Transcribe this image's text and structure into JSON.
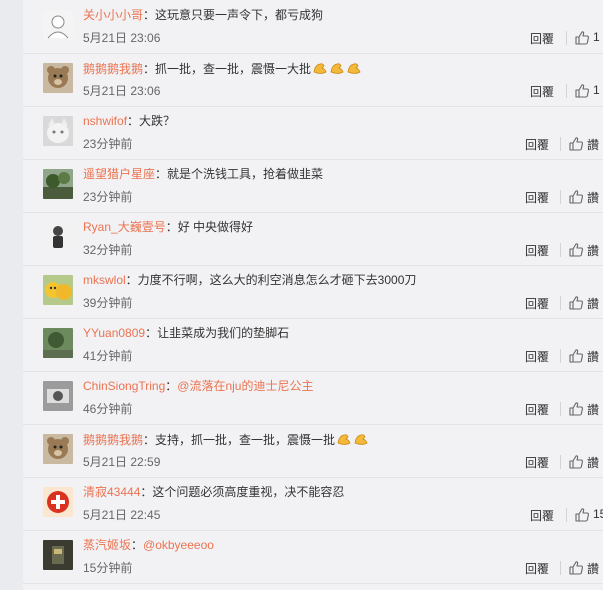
{
  "comments": [
    {
      "name": "关小小小哥",
      "text": "：这玩意只要一声令下，都亏成狗",
      "time": "5月21日 23:06",
      "reply": "回覆",
      "like": "1",
      "avatar": "avatar-white"
    },
    {
      "name": "鹅鹅鹅我鹅",
      "text": "：抓一批，查一批，震慑一大批",
      "time": "5月21日 23:06",
      "reply": "回覆",
      "like": "1",
      "avatar": "avatar-bear",
      "emoji": 3
    },
    {
      "name": "nshwifof",
      "text": "：大跌？",
      "time": "23分钟前",
      "reply": "回覆",
      "like": "讚",
      "avatar": "avatar-cat"
    },
    {
      "name": "遥望猎户星座",
      "text": "：就是个洗钱工具，抢着做韭菜",
      "time": "23分钟前",
      "reply": "回覆",
      "like": "讚",
      "avatar": "avatar-tree"
    },
    {
      "name": "Ryan_大巍壹号",
      "text": "：好  中央做得好",
      "time": "32分钟前",
      "reply": "回覆",
      "like": "讚",
      "avatar": "avatar-figure"
    },
    {
      "name": "mkswlol",
      "text": "：力度不行啊，这么大的利空消息怎么才砸下去3000刀",
      "time": "39分钟前",
      "reply": "回覆",
      "like": "讚",
      "avatar": "avatar-yellow"
    },
    {
      "name": "YYuan0809",
      "text": "：让韭菜成为我们的垫脚石",
      "time": "41分钟前",
      "reply": "回覆",
      "like": "讚",
      "avatar": "avatar-green"
    },
    {
      "name": "ChinSiongTring",
      "text": "：",
      "mention": "@流落在nju的迪士尼公主",
      "time": "46分钟前",
      "reply": "回覆",
      "like": "讚",
      "avatar": "avatar-gray"
    },
    {
      "name": "鹅鹅鹅我鹅",
      "text": "：支持，抓一批，查一批，震慑一批",
      "time": "5月21日 22:59",
      "reply": "回覆",
      "like": "讚",
      "avatar": "avatar-bear",
      "emoji": 2
    },
    {
      "name": "清寂43444",
      "text": "：这个问题必须高度重视，决不能容忍",
      "time": "5月21日 22:45",
      "reply": "回覆",
      "like": "15",
      "avatar": "avatar-red"
    },
    {
      "name": "蒸汽姬坂",
      "text": "：",
      "mention": "@okbyeeeoo",
      "time": "15分钟前",
      "reply": "回覆",
      "like": "讚",
      "avatar": "avatar-dark"
    }
  ]
}
